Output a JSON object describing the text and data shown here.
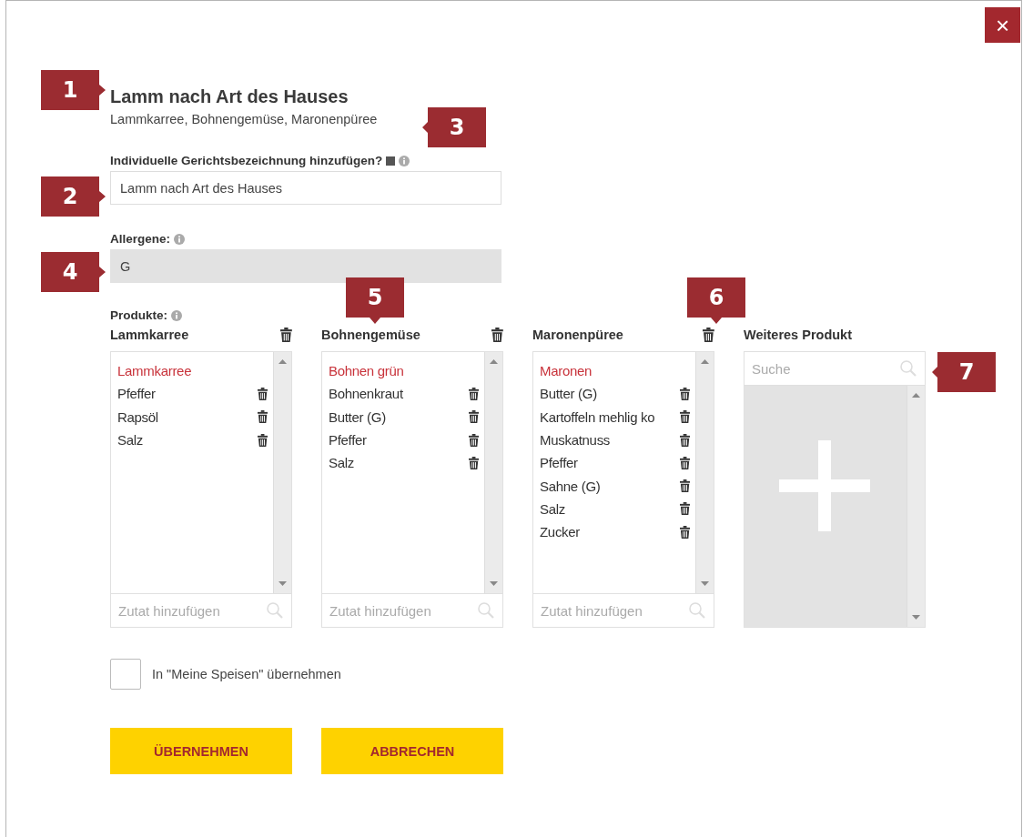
{
  "close_button": "×",
  "title": "Lamm nach Art des Hauses",
  "subtitle": "Lammkarree, Bohnengemüse, Maronenpüree",
  "custom_name": {
    "label": "Individuelle Gerichtsbezeichnung hinzufügen?",
    "checked": true,
    "value": "Lamm nach Art des Hauses"
  },
  "allergens": {
    "label": "Allergene:",
    "value": "G"
  },
  "products_label": "Produkte:",
  "columns": [
    {
      "title": "Lammkarree",
      "placeholder": "Zutat hinzufügen",
      "items": [
        {
          "name": "Lammkarree",
          "kind": "main"
        },
        {
          "name": "Pfeffer",
          "kind": "ingredient"
        },
        {
          "name": "Rapsöl",
          "kind": "ingredient"
        },
        {
          "name": "Salz",
          "kind": "ingredient"
        }
      ]
    },
    {
      "title": "Bohnengemüse",
      "placeholder": "Zutat hinzufügen",
      "items": [
        {
          "name": "Bohnen grün",
          "kind": "main"
        },
        {
          "name": "Bohnenkraut",
          "kind": "ingredient"
        },
        {
          "name": "Butter (G)",
          "kind": "ingredient"
        },
        {
          "name": "Pfeffer",
          "kind": "ingredient"
        },
        {
          "name": "Salz",
          "kind": "ingredient"
        }
      ]
    },
    {
      "title": "Maronenpüree",
      "placeholder": "Zutat hinzufügen",
      "items": [
        {
          "name": "Maronen",
          "kind": "main"
        },
        {
          "name": "Butter (G)",
          "kind": "ingredient"
        },
        {
          "name": "Kartoffeln mehlig ko",
          "kind": "ingredient"
        },
        {
          "name": "Muskatnuss",
          "kind": "ingredient"
        },
        {
          "name": "Pfeffer",
          "kind": "ingredient"
        },
        {
          "name": "Sahne (G)",
          "kind": "ingredient"
        },
        {
          "name": "Salz",
          "kind": "ingredient"
        },
        {
          "name": "Zucker",
          "kind": "ingredient"
        }
      ]
    }
  ],
  "further_product": {
    "title": "Weiteres Produkt",
    "placeholder": "Suche"
  },
  "save_to_mine": {
    "label": "In \"Meine Speisen\" übernehmen",
    "checked": false
  },
  "buttons": [
    "ÜBERNEHMEN",
    "ABBRECHEN"
  ],
  "callouts": [
    {
      "number": "1"
    },
    {
      "number": "2"
    },
    {
      "number": "3"
    },
    {
      "number": "4"
    },
    {
      "number": "5"
    },
    {
      "number": "6"
    },
    {
      "number": "7"
    }
  ]
}
